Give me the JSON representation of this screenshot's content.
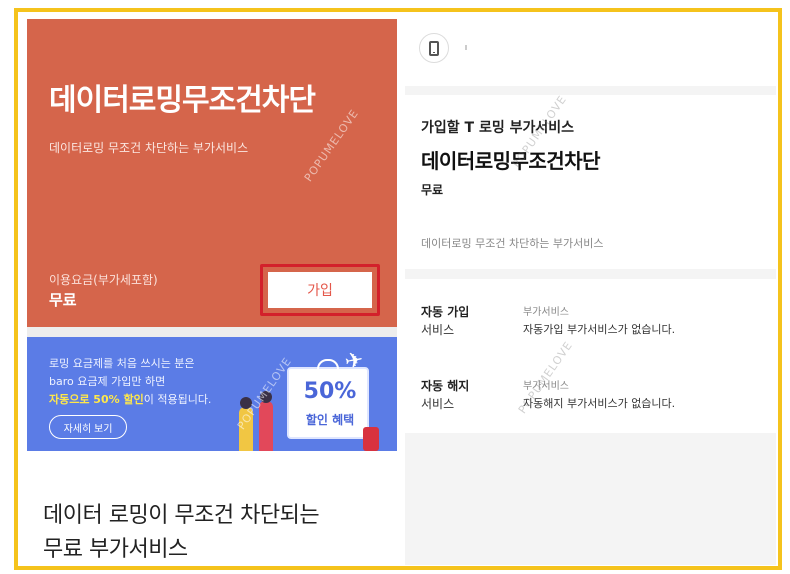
{
  "left": {
    "hero": {
      "title": "데이터로밍무조건차단",
      "description": "데이터로밍 무조건 차단하는 부가서비스",
      "fee_label": "이용요금(부가세포함)",
      "fee_value": "무료",
      "join_label": "가입"
    },
    "banner": {
      "line1": "로밍 요금제를 처음 쓰시는 분은",
      "line2": "baro 요금제 가입만 하면",
      "line3_highlight": "자동으로 50% 할인",
      "line3_rest": "이 적용됩니다.",
      "detail_button": "자세히 보기",
      "badge_percent": "50%",
      "badge_text": "할인 혜택"
    },
    "section_text_line1": "데이터 로밍이 무조건 차단되는",
    "section_text_line2": "무료 부가서비스"
  },
  "right": {
    "info": {
      "label": "가입할 T 로밍 부가서비스",
      "title": "데이터로밍무조건차단",
      "price": "무료",
      "description": "데이터로밍 무조건 차단하는 부가서비스"
    },
    "services": [
      {
        "heading1": "자동 가입",
        "heading2": "서비스",
        "category": "부가서비스",
        "message": "자동가입 부가서비스가 없습니다."
      },
      {
        "heading1": "자동 해지",
        "heading2": "서비스",
        "category": "부가서비스",
        "message": "자동해지 부가서비스가 없습니다."
      }
    ]
  },
  "watermark": "POPUMELOVE",
  "colors": {
    "hero": "#d5654b",
    "banner": "#5b7ce6",
    "highlight": "#ffe84a",
    "frame": "#f5c31c",
    "outline": "#d3202b"
  },
  "icons": {
    "phone": "phone-icon",
    "plane": "airplane-icon",
    "gift": "gift-box-icon"
  }
}
